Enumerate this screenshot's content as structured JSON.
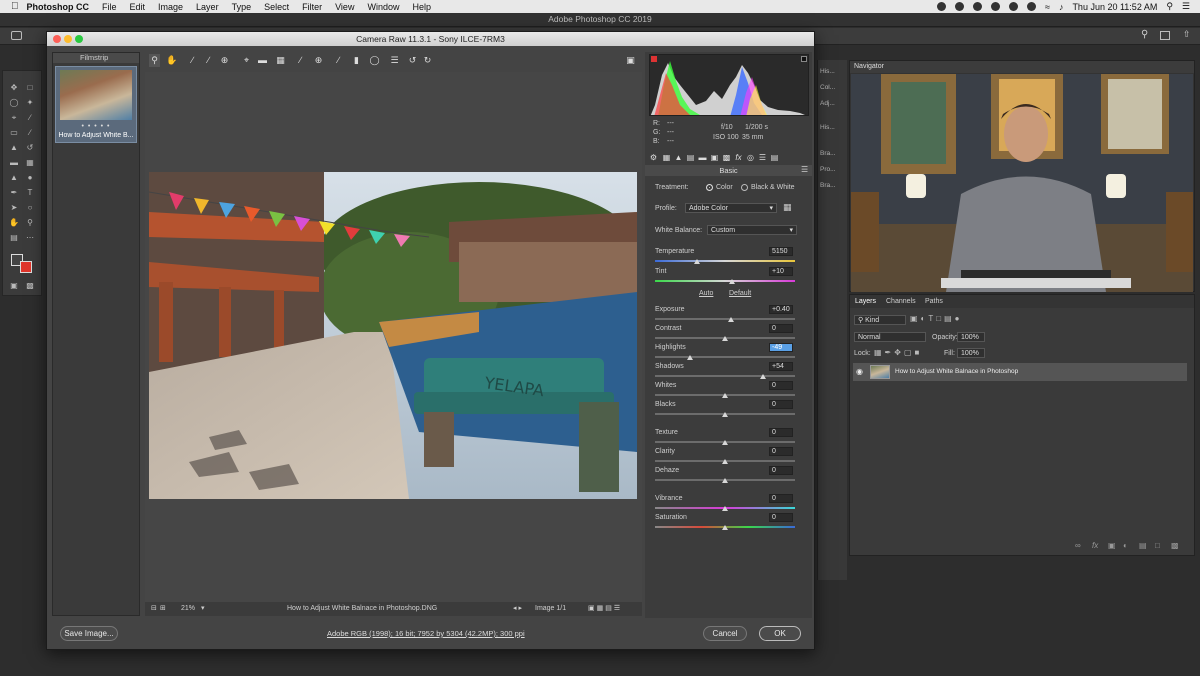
{
  "menubar": {
    "app_name": "Photoshop CC",
    "menus": [
      "File",
      "Edit",
      "Image",
      "Layer",
      "Type",
      "Select",
      "Filter",
      "View",
      "Window",
      "Help"
    ],
    "clock": "Thu Jun 20  11:52 AM"
  },
  "app": {
    "title": "Adobe Photoshop CC 2019"
  },
  "camera_raw": {
    "window_title": "Camera Raw 11.3.1  -  Sony ILCE-7RM3",
    "filmstrip": {
      "label": "Filmstrip",
      "thumb_name": "How to Adjust White B...",
      "rating_dots": "• • • • •"
    },
    "status": {
      "zoom": "21%",
      "filename": "How to Adjust White Balnace in Photoshop.DNG",
      "image_count": "Image 1/1"
    },
    "footer": {
      "save_label": "Save Image...",
      "workflow_info": "Adobe RGB (1998); 16 bit; 7952 by 5304 (42.2MP); 300 ppi",
      "cancel_label": "Cancel",
      "ok_label": "OK"
    },
    "readout": {
      "r_label": "R:",
      "g_label": "G:",
      "b_label": "B:",
      "r": "---",
      "g": "---",
      "b": "---",
      "aperture": "f/10",
      "shutter": "1/200 s",
      "iso": "ISO 100",
      "focal": "35 mm"
    },
    "basic": {
      "title": "Basic",
      "treatment_label": "Treatment:",
      "treatment_color": "Color",
      "treatment_bw": "Black & White",
      "profile_label": "Profile:",
      "profile_value": "Adobe Color",
      "wb_label": "White Balance:",
      "wb_value": "Custom",
      "auto_label": "Auto",
      "default_label": "Default",
      "sliders": [
        {
          "label": "Temperature",
          "value": "5150",
          "pos": 0.3
        },
        {
          "label": "Tint",
          "value": "+10",
          "pos": 0.55
        },
        {
          "label": "Exposure",
          "value": "+0.40",
          "pos": 0.54
        },
        {
          "label": "Contrast",
          "value": "0",
          "pos": 0.5
        },
        {
          "label": "Highlights",
          "value": "-49",
          "pos": 0.25
        },
        {
          "label": "Shadows",
          "value": "+54",
          "pos": 0.77
        },
        {
          "label": "Whites",
          "value": "0",
          "pos": 0.5
        },
        {
          "label": "Blacks",
          "value": "0",
          "pos": 0.5
        },
        {
          "label": "Texture",
          "value": "0",
          "pos": 0.5
        },
        {
          "label": "Clarity",
          "value": "0",
          "pos": 0.5
        },
        {
          "label": "Dehaze",
          "value": "0",
          "pos": 0.5
        },
        {
          "label": "Vibrance",
          "value": "0",
          "pos": 0.5
        },
        {
          "label": "Saturation",
          "value": "0",
          "pos": 0.5
        }
      ]
    }
  },
  "side_icons": [
    "His...",
    "Col...",
    "Adj...",
    "His...",
    "Bra...",
    "Pro...",
    "Bra..."
  ],
  "navigator": {
    "title": "Navigator"
  },
  "layers": {
    "tabs": [
      "Layers",
      "Channels",
      "Paths"
    ],
    "kind_label": "Kind",
    "blend_mode": "Normal",
    "opacity_label": "Opacity:",
    "opacity_value": "100%",
    "lock_label": "Lock:",
    "fill_label": "Fill:",
    "fill_value": "100%",
    "layer_name": "How to Adjust White Balnace in Photoshop"
  },
  "colors": {
    "accent_blue": "#5aa0e6",
    "bg_color": "#e0352b"
  }
}
